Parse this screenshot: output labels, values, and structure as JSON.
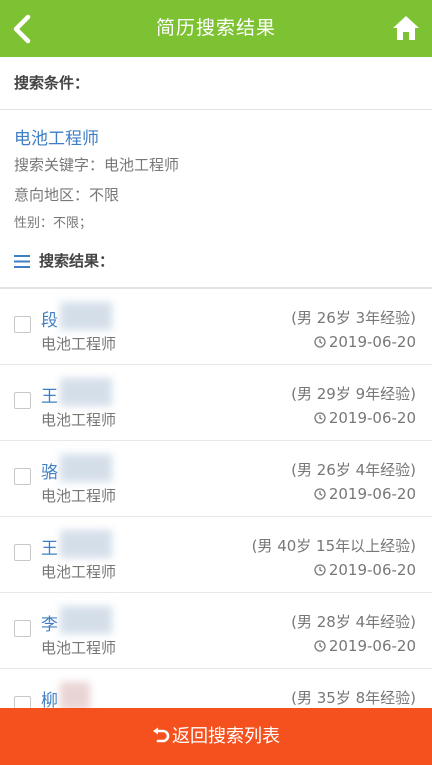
{
  "header": {
    "title": "简历搜索结果",
    "back_icon": "chevron-left-icon",
    "home_icon": "home-icon",
    "bg_color": "#7dc232"
  },
  "criteria": {
    "heading": "搜索条件：",
    "job_title": "电池工程师",
    "keyword_line": "搜索关键字：电池工程师",
    "region_line": "意向地区：不限",
    "gender_line": "性别：不限；"
  },
  "results": {
    "heading": "搜索结果：",
    "items": [
      {
        "name": "段",
        "position": "电池工程师",
        "meta": "(男  26岁  3年经验)",
        "date": "2019-06-20"
      },
      {
        "name": "王",
        "position": "电池工程师",
        "meta": "(男  29岁  9年经验)",
        "date": "2019-06-20"
      },
      {
        "name": "骆",
        "position": "电池工程师",
        "meta": "(男  26岁  4年经验)",
        "date": "2019-06-20"
      },
      {
        "name": "王",
        "position": "电池工程师",
        "meta": "(男  40岁  15年以上经验)",
        "date": "2019-06-20"
      },
      {
        "name": "李",
        "position": "电池工程师",
        "meta": "(男  28岁  4年经验)",
        "date": "2019-06-20"
      },
      {
        "name": "柳",
        "position": "",
        "meta": "(男  35岁  8年经验)",
        "date": ""
      }
    ]
  },
  "footer": {
    "back_label": "返回搜索列表",
    "icon": "undo-arrow-icon",
    "bg_color": "#f4511e"
  }
}
